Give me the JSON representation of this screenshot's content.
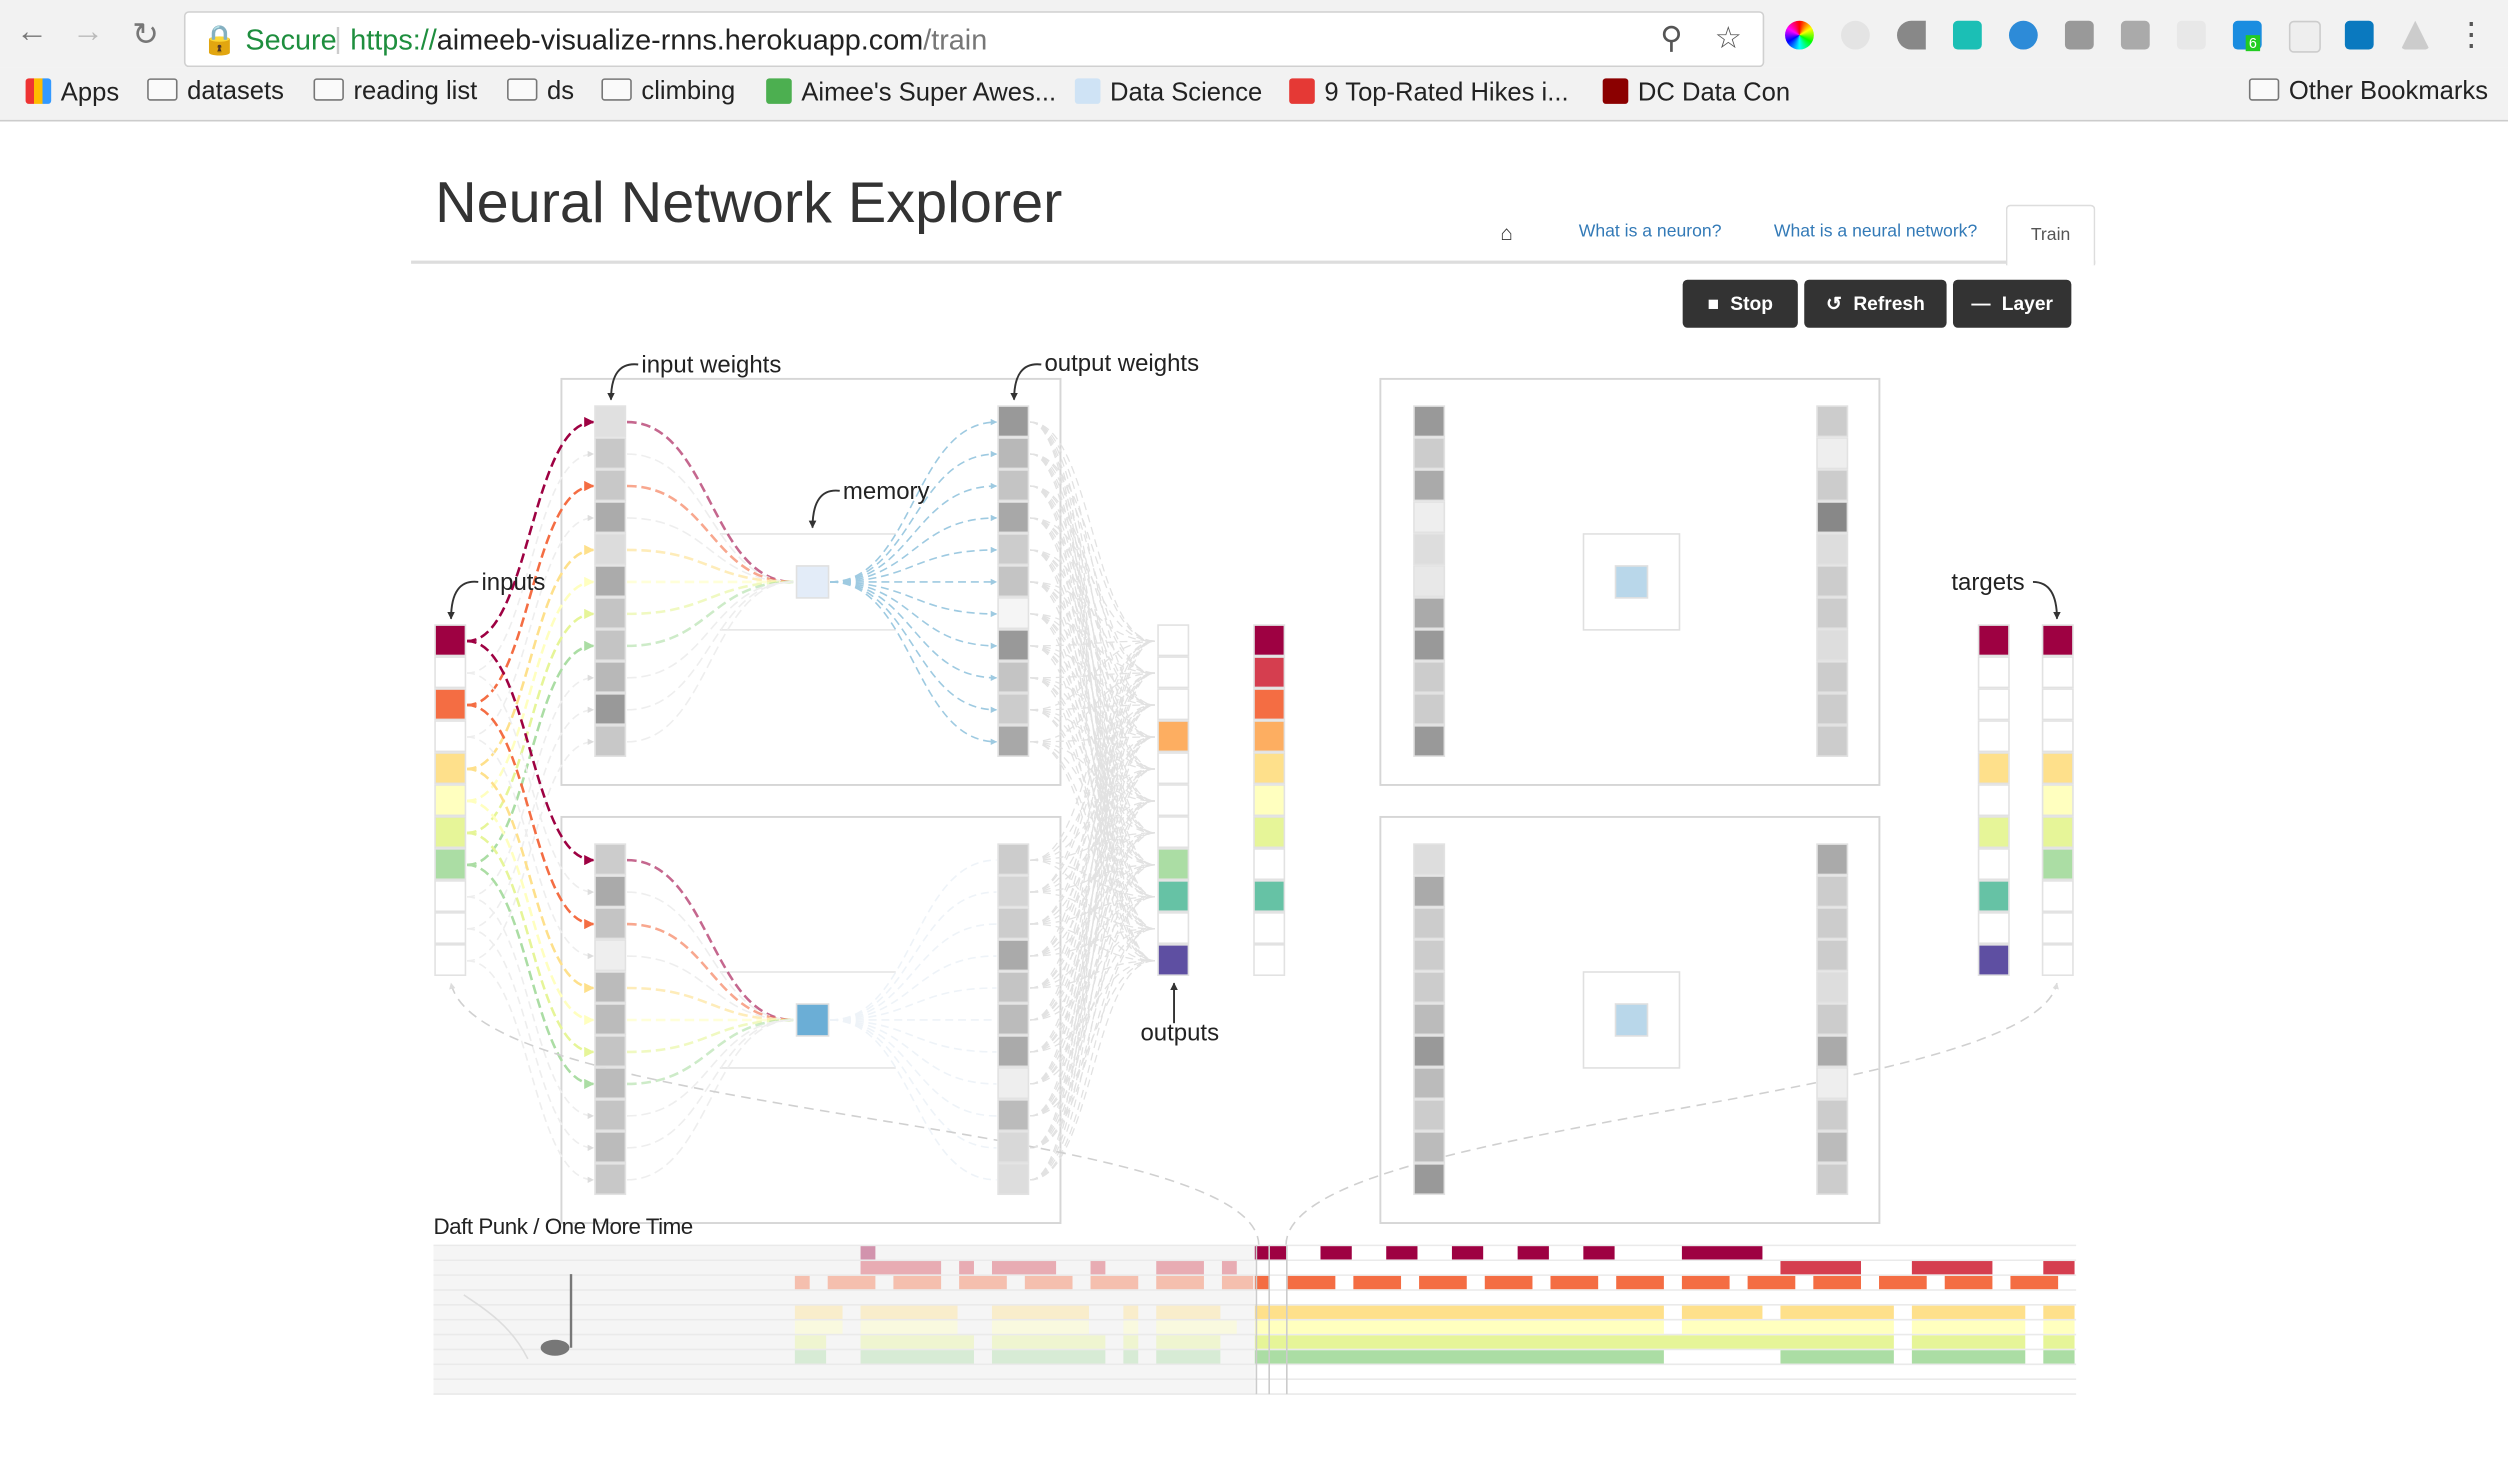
{
  "browser": {
    "secure_label": "Secure",
    "url_scheme": "https://",
    "url_host": "aimeeb-visualize-rnns.herokuapp.com",
    "url_path": "/train",
    "bookmarks": [
      {
        "label": "Apps",
        "icon": "apps-grid-icon"
      },
      {
        "label": "datasets",
        "icon": "folder-icon"
      },
      {
        "label": "reading list",
        "icon": "folder-icon"
      },
      {
        "label": "ds",
        "icon": "folder-icon"
      },
      {
        "label": "climbing",
        "icon": "folder-icon"
      },
      {
        "label": "Aimee's Super Awes...",
        "icon": "trello-icon"
      },
      {
        "label": "Data Science",
        "icon": "reddit-icon"
      },
      {
        "label": "9 Top-Rated Hikes i...",
        "icon": "hike-site-icon"
      },
      {
        "label": "DC Data Con",
        "icon": "dc-data-icon"
      }
    ],
    "other_bookmarks": "Other Bookmarks",
    "extension_badge": "6"
  },
  "header": {
    "title": "Neural Network Explorer",
    "nav": [
      {
        "label": "What is a neuron?"
      },
      {
        "label": "What is a neural network?"
      },
      {
        "label": "Train",
        "active": true
      }
    ]
  },
  "controls": {
    "stop": "Stop",
    "refresh": "Refresh",
    "layer": "Layer"
  },
  "labels": {
    "input_weights": "input weights",
    "output_weights": "output weights",
    "memory": "memory",
    "inputs": "inputs",
    "outputs": "outputs",
    "targets": "targets"
  },
  "palette": [
    "#9e0142",
    "#d53e4f",
    "#f46d43",
    "#fdae61",
    "#fee08b",
    "#ffffbf",
    "#e6f598",
    "#abdda4",
    "#66c2a5",
    "#3288bd",
    "#5e4fa2"
  ],
  "network": {
    "inputs_active": [
      1,
      0,
      1,
      0,
      1,
      1,
      1,
      1,
      0,
      0,
      0
    ],
    "outputs_active": [
      0,
      0,
      0,
      1,
      0,
      0,
      0,
      1,
      1,
      0,
      1
    ],
    "output_probs_active": [
      1,
      1,
      1,
      1,
      1,
      1,
      1,
      0,
      1,
      0,
      0
    ],
    "targets_a_active": [
      1,
      0,
      0,
      0,
      1,
      0,
      1,
      0,
      1,
      0,
      1
    ],
    "targets_b_active": [
      1,
      0,
      0,
      0,
      1,
      1,
      1,
      1,
      0,
      0,
      0
    ],
    "layer1": {
      "top": {
        "in_w": [
          "#e0e0e0",
          "#c8c8c8",
          "#c8c8c8",
          "#ababab",
          "#dcdcdc",
          "#ababab",
          "#c4c4c4",
          "#c4c4c4",
          "#b8b8b8",
          "#999999",
          "#c8c8c8"
        ],
        "out_w": [
          "#999999",
          "#b8b8b8",
          "#c4c4c4",
          "#a8a8a8",
          "#cccccc",
          "#c4c4c4",
          "#f5f5f5",
          "#999999",
          "#c4c4c4",
          "#cccccc",
          "#a8a8a8"
        ],
        "memory": "#e3ecf8"
      },
      "bottom": {
        "in_w": [
          "#cccccc",
          "#aaaaaa",
          "#c4c4c4",
          "#eeeeee",
          "#bbbbbb",
          "#bbbbbb",
          "#c4c4c4",
          "#bbbbbb",
          "#c4c4c4",
          "#bbbbbb",
          "#c8c8c8"
        ],
        "out_w": [
          "#cccccc",
          "#d4d4d4",
          "#cccccc",
          "#aaaaaa",
          "#c4c4c4",
          "#bbbbbb",
          "#aaaaaa",
          "#eeeeee",
          "#bbbbbb",
          "#d8d8d8",
          "#dddddd"
        ],
        "memory": "#6baed6"
      }
    },
    "layer2": {
      "top": {
        "in_w": [
          "#999999",
          "#cccccc",
          "#aaaaaa",
          "#eeeeee",
          "#dddddd",
          "#e8e8e8",
          "#aaaaaa",
          "#999999",
          "#cccccc",
          "#cccccc",
          "#999999"
        ],
        "out_w": [
          "#cccccc",
          "#eeeeee",
          "#cccccc",
          "#888888",
          "#dddddd",
          "#cccccc",
          "#cccccc",
          "#dddddd",
          "#cccccc",
          "#cccccc",
          "#cccccc"
        ],
        "memory": "#b9d7ea"
      },
      "bottom": {
        "in_w": [
          "#dddddd",
          "#aaaaaa",
          "#cccccc",
          "#cccccc",
          "#cccccc",
          "#bbbbbb",
          "#999999",
          "#bbbbbb",
          "#cccccc",
          "#bbbbbb",
          "#999999"
        ],
        "out_w": [
          "#aaaaaa",
          "#cccccc",
          "#cccccc",
          "#cccccc",
          "#dddddd",
          "#cccccc",
          "#aaaaaa",
          "#eeeeee",
          "#cccccc",
          "#bbbbbb",
          "#cccccc"
        ],
        "memory": "#b9d7ea"
      }
    }
  },
  "song": {
    "title": "Daft Punk / One More Time",
    "total_steps": 100,
    "current_step": 50,
    "rows": [
      [
        [
          26,
          1
        ],
        [
          50,
          2
        ],
        [
          54,
          2
        ],
        [
          58,
          2
        ],
        [
          62,
          2
        ],
        [
          66,
          2
        ],
        [
          70,
          2
        ],
        [
          76,
          5
        ]
      ],
      [
        [
          26,
          5
        ],
        [
          32,
          1
        ],
        [
          34,
          4
        ],
        [
          40,
          1
        ],
        [
          44,
          3
        ],
        [
          48,
          1
        ],
        [
          82,
          5
        ],
        [
          90,
          5
        ],
        [
          98,
          2
        ]
      ],
      [
        [
          22,
          1
        ],
        [
          24,
          3
        ],
        [
          28,
          3
        ],
        [
          32,
          3
        ],
        [
          36,
          3
        ],
        [
          40,
          3
        ],
        [
          44,
          3
        ],
        [
          48,
          3
        ],
        [
          52,
          3
        ],
        [
          56,
          3
        ],
        [
          60,
          3
        ],
        [
          64,
          3
        ],
        [
          68,
          3
        ],
        [
          72,
          3
        ],
        [
          76,
          3
        ],
        [
          80,
          3
        ],
        [
          84,
          3
        ],
        [
          88,
          3
        ],
        [
          92,
          3
        ],
        [
          96,
          3
        ]
      ],
      [],
      [
        [
          22,
          3
        ],
        [
          26,
          6
        ],
        [
          34,
          6
        ],
        [
          42,
          1
        ],
        [
          44,
          4
        ],
        [
          50,
          25
        ],
        [
          76,
          5
        ],
        [
          82,
          7
        ],
        [
          90,
          7
        ],
        [
          98,
          2
        ]
      ],
      [
        [
          22,
          3
        ],
        [
          26,
          6
        ],
        [
          34,
          6
        ],
        [
          42,
          1
        ],
        [
          44,
          5
        ],
        [
          50,
          25
        ],
        [
          76,
          13
        ],
        [
          90,
          7
        ],
        [
          98,
          2
        ]
      ],
      [
        [
          22,
          2
        ],
        [
          26,
          7
        ],
        [
          34,
          7
        ],
        [
          42,
          1
        ],
        [
          44,
          4
        ],
        [
          50,
          39
        ],
        [
          90,
          7
        ],
        [
          98,
          2
        ]
      ],
      [
        [
          22,
          2
        ],
        [
          26,
          7
        ],
        [
          34,
          7
        ],
        [
          42,
          1
        ],
        [
          44,
          4
        ],
        [
          50,
          25
        ],
        [
          82,
          7
        ],
        [
          90,
          7
        ],
        [
          98,
          2
        ]
      ],
      [],
      []
    ]
  }
}
